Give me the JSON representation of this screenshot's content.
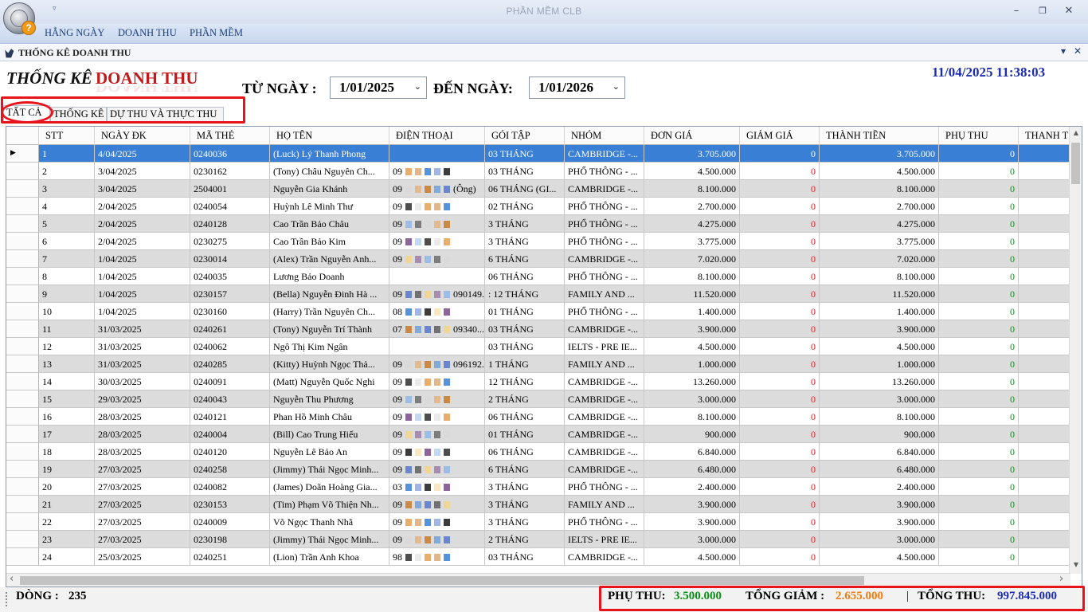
{
  "window": {
    "title": "PHẦN MỀM CLB",
    "app_badge": "?",
    "qat_arrow": "▿",
    "min": "–",
    "max": "❐",
    "close": "✕"
  },
  "menu": [
    "HẰNG NGÀY",
    "DOANH THU",
    "PHẦN MỀM"
  ],
  "doc_tab": {
    "title": "THỐNG KÊ DOANH THU",
    "pin": "▾",
    "close": "✕"
  },
  "header": {
    "title_a": "THỐNG KÊ",
    "title_b": "DOANH THU",
    "from_label": "TỪ NGÀY :",
    "from_value": "1/01/2025",
    "to_label": "ĐẾN NGÀY:",
    "to_value": "1/01/2026",
    "chevron": "⌄",
    "datetime": "11/04/2025 11:38:03"
  },
  "tabs": [
    "TẤT CẢ",
    "THỐNG KÊ",
    "DỰ THU VÀ THỰC THU"
  ],
  "columns": [
    "STT",
    "NGÀY ĐK",
    "MÃ THẺ",
    "HỌ TÊN",
    "ĐIỆN THOẠI",
    "GÓI TẬP",
    "NHÓM",
    "ĐƠN GIÁ",
    "GIẢM GIÁ",
    "THÀNH TIỀN",
    "PHỤ THU",
    "THANH T"
  ],
  "rows": [
    {
      "stt": "1",
      "date": "4/04/2025",
      "card": "0240036",
      "name": "(Luck) Lý Thanh Phong",
      "phone": "",
      "pkg": "03 THÁNG",
      "group": "CAMBRIDGE -...",
      "price": "3.705.000",
      "disc": "0",
      "total": "3.705.000",
      "extra": "0"
    },
    {
      "stt": "2",
      "date": "3/04/2025",
      "card": "0230162",
      "name": "(Tony) Châu Nguyên Ch...",
      "phone": "09",
      "pkg": "03 THÁNG",
      "group": "PHỔ THÔNG - ...",
      "price": "4.500.000",
      "disc": "0",
      "total": "4.500.000",
      "extra": "0"
    },
    {
      "stt": "3",
      "date": "3/04/2025",
      "card": "2504001",
      "name": "Nguyễn Gia Khánh",
      "phone": "09",
      "phone_tail": "(Ông)",
      "pkg": "06 THÁNG (GI...",
      "group": "CAMBRIDGE -...",
      "price": "8.100.000",
      "disc": "0",
      "total": "8.100.000",
      "extra": "0"
    },
    {
      "stt": "4",
      "date": "2/04/2025",
      "card": "0240054",
      "name": "Huỳnh Lê Minh Thư",
      "phone": "09",
      "pkg": "02 THÁNG",
      "group": "PHỔ THÔNG - ...",
      "price": "2.700.000",
      "disc": "0",
      "total": "2.700.000",
      "extra": "0"
    },
    {
      "stt": "5",
      "date": "2/04/2025",
      "card": "0240128",
      "name": "Cao Trần Bảo Châu",
      "phone": "09",
      "pkg": "3 THÁNG",
      "group": "PHỔ THÔNG - ...",
      "price": "4.275.000",
      "disc": "0",
      "total": "4.275.000",
      "extra": "0"
    },
    {
      "stt": "6",
      "date": "2/04/2025",
      "card": "0230275",
      "name": "Cao Trần Bảo Kim",
      "phone": "09",
      "pkg": "3 THÁNG",
      "group": "PHỔ THÔNG - ...",
      "price": "3.775.000",
      "disc": "0",
      "total": "3.775.000",
      "extra": "0"
    },
    {
      "stt": "7",
      "date": "1/04/2025",
      "card": "0230014",
      "name": "(Alex) Trần Nguyễn Anh...",
      "phone": "09",
      "pkg": "6 THÁNG",
      "group": "CAMBRIDGE -...",
      "price": "7.020.000",
      "disc": "0",
      "total": "7.020.000",
      "extra": "0"
    },
    {
      "stt": "8",
      "date": "1/04/2025",
      "card": "0240035",
      "name": "Lương Bảo Doanh",
      "phone": "",
      "pkg": "06 THÁNG",
      "group": "PHỔ THÔNG - ...",
      "price": "8.100.000",
      "disc": "0",
      "total": "8.100.000",
      "extra": "0"
    },
    {
      "stt": "9",
      "date": "1/04/2025",
      "card": "0230157",
      "name": "(Bella) Nguyễn Đinh Hà ...",
      "phone": "09",
      "phone_tail": "090149...",
      "pkg": ": 12 THÁNG",
      "group": "FAMILY AND ...",
      "price": "11.520.000",
      "disc": "0",
      "total": "11.520.000",
      "extra": "0"
    },
    {
      "stt": "10",
      "date": "1/04/2025",
      "card": "0230160",
      "name": "(Harry) Trần Nguyên Ch...",
      "phone": "08",
      "pkg": "01 THÁNG",
      "group": "PHỔ THÔNG - ...",
      "price": "1.400.000",
      "disc": "0",
      "total": "1.400.000",
      "extra": "0"
    },
    {
      "stt": "11",
      "date": "31/03/2025",
      "card": "0240261",
      "name": "(Tony) Nguyễn Trí Thành",
      "phone": "07",
      "phone_tail": "09340...",
      "pkg": "03 THÁNG",
      "group": "CAMBRIDGE -...",
      "price": "3.900.000",
      "disc": "0",
      "total": "3.900.000",
      "extra": "0"
    },
    {
      "stt": "12",
      "date": "31/03/2025",
      "card": "0240062",
      "name": "Ngô Thị Kim Ngân",
      "phone": "",
      "pkg": "03 THÁNG",
      "group": "IELTS - PRE IE...",
      "price": "4.500.000",
      "disc": "0",
      "total": "4.500.000",
      "extra": "0"
    },
    {
      "stt": "13",
      "date": "31/03/2025",
      "card": "0240285",
      "name": "(Kitty) Huỳnh Ngọc Thả...",
      "phone": "09",
      "phone_tail": "096192...",
      "pkg": "1 THÁNG",
      "group": "FAMILY AND ...",
      "price": "1.000.000",
      "disc": "0",
      "total": "1.000.000",
      "extra": "0"
    },
    {
      "stt": "14",
      "date": "30/03/2025",
      "card": "0240091",
      "name": "(Matt) Nguyễn Quốc Nghi",
      "phone": "09",
      "pkg": "12 THÁNG",
      "group": "CAMBRIDGE -...",
      "price": "13.260.000",
      "disc": "0",
      "total": "13.260.000",
      "extra": "0"
    },
    {
      "stt": "15",
      "date": "29/03/2025",
      "card": "0240043",
      "name": "Nguyễn Thu Phương",
      "phone": "09",
      "pkg": "2 THÁNG",
      "group": "CAMBRIDGE -...",
      "price": "3.000.000",
      "disc": "0",
      "total": "3.000.000",
      "extra": "0"
    },
    {
      "stt": "16",
      "date": "28/03/2025",
      "card": "0240121",
      "name": "Phan Hồ Minh Châu",
      "phone": "09",
      "pkg": "06 THÁNG",
      "group": "CAMBRIDGE -...",
      "price": "8.100.000",
      "disc": "0",
      "total": "8.100.000",
      "extra": "0"
    },
    {
      "stt": "17",
      "date": "28/03/2025",
      "card": "0240004",
      "name": "(Bill) Cao Trung Hiếu",
      "phone": "09",
      "pkg": "01 THÁNG",
      "group": "CAMBRIDGE -...",
      "price": "900.000",
      "disc": "0",
      "total": "900.000",
      "extra": "0"
    },
    {
      "stt": "18",
      "date": "28/03/2025",
      "card": "0240120",
      "name": "Nguyễn Lê Bảo An",
      "phone": "09",
      "pkg": "06 THÁNG",
      "group": "CAMBRIDGE -...",
      "price": "6.840.000",
      "disc": "0",
      "total": "6.840.000",
      "extra": "0"
    },
    {
      "stt": "19",
      "date": "27/03/2025",
      "card": "0240258",
      "name": "(Jimmy) Thái Ngọc Minh...",
      "phone": "09",
      "pkg": "6 THÁNG",
      "group": "CAMBRIDGE -...",
      "price": "6.480.000",
      "disc": "0",
      "total": "6.480.000",
      "extra": "0"
    },
    {
      "stt": "20",
      "date": "27/03/2025",
      "card": "0240082",
      "name": "(James) Doãn Hoàng Gia...",
      "phone": "03",
      "pkg": "3 THÁNG",
      "group": "PHỔ THÔNG - ...",
      "price": "2.400.000",
      "disc": "0",
      "total": "2.400.000",
      "extra": "0"
    },
    {
      "stt": "21",
      "date": "27/03/2025",
      "card": "0230153",
      "name": "(Tim) Phạm Võ Thiện Nh...",
      "phone": "09",
      "pkg": "3 THÁNG",
      "group": "FAMILY AND ...",
      "price": "3.900.000",
      "disc": "0",
      "total": "3.900.000",
      "extra": "0"
    },
    {
      "stt": "22",
      "date": "27/03/2025",
      "card": "0240009",
      "name": "Võ Ngọc Thanh Nhã",
      "phone": "09",
      "pkg": "3 THÁNG",
      "group": "PHỔ THÔNG - ...",
      "price": "3.900.000",
      "disc": "0",
      "total": "3.900.000",
      "extra": "0"
    },
    {
      "stt": "23",
      "date": "27/03/2025",
      "card": "0230198",
      "name": "(Jimmy) Thái Ngọc Minh...",
      "phone": "09",
      "pkg": "2 THÁNG",
      "group": "IELTS - PRE IE...",
      "price": "3.000.000",
      "disc": "0",
      "total": "3.000.000",
      "extra": "0"
    },
    {
      "stt": "24",
      "date": "25/03/2025",
      "card": "0240251",
      "name": "(Lion) Trần Anh Khoa",
      "phone": "98",
      "pkg": "03 THÁNG",
      "group": "CAMBRIDGE -...",
      "price": "4.500.000",
      "disc": "0",
      "total": "4.500.000",
      "extra": "0"
    }
  ],
  "row_marker": "▶",
  "scroll": {
    "up": "▲",
    "down": "▼",
    "left": "‹",
    "right": "›"
  },
  "status": {
    "rows_label": "DÒNG :",
    "rows_value": "235",
    "extra_label": "PHỤ THU:",
    "extra_value": "3.500.000",
    "discount_label": "TỔNG GIẢM :",
    "discount_value": "2.655.000",
    "sep": "|",
    "total_label": "TỔNG THU:",
    "total_value": "997.845.000"
  },
  "colors": {
    "title_red": "#c21a1a",
    "datetime_blue": "#1c2cb0",
    "selection": "#3a7fd6",
    "zero_red": "#e8141c",
    "zero_green": "#0b8f15",
    "extra_green": "#0b8f15",
    "discount_orange": "#f07c12",
    "total_blue": "#1c2cb0",
    "highlight": "#e8141c"
  }
}
